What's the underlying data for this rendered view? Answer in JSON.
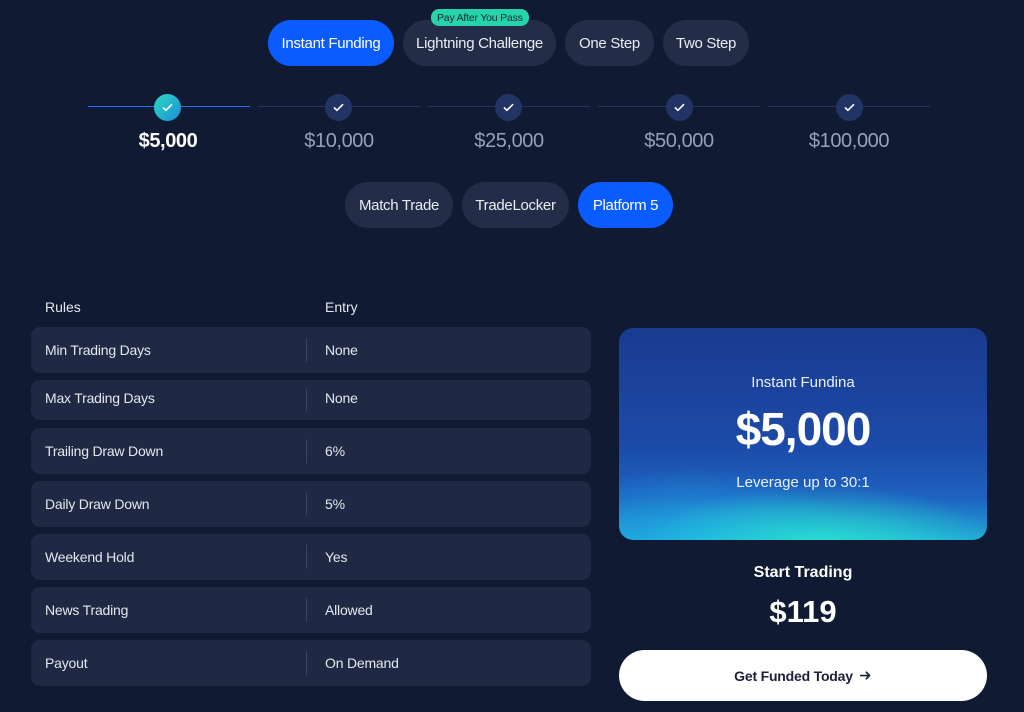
{
  "programs": {
    "items": [
      {
        "label": "Instant Funding",
        "active": true
      },
      {
        "label": "Lightning Challenge",
        "active": false
      },
      {
        "label": "One Step",
        "active": false
      },
      {
        "label": "Two Step",
        "active": false
      }
    ],
    "badge": "Pay After You Pass"
  },
  "account_sizes": [
    "$5,000",
    "$10,000",
    "$25,000",
    "$50,000",
    "$100,000"
  ],
  "selected_size_index": 0,
  "platforms": [
    {
      "label": "Match Trade",
      "active": false
    },
    {
      "label": "TradeLocker",
      "active": false
    },
    {
      "label": "Platform 5",
      "active": true
    }
  ],
  "rules_table": {
    "headers": {
      "rules": "Rules",
      "entry": "Entry"
    },
    "rows": [
      {
        "rule": "Min Trading Days",
        "entry": "None"
      },
      {
        "rule": "Max Trading Days",
        "entry": "None"
      },
      {
        "rule": "Trailing Draw Down",
        "entry": "6%"
      },
      {
        "rule": "Daily Draw Down",
        "entry": "5%"
      },
      {
        "rule": "Weekend Hold",
        "entry": "Yes"
      },
      {
        "rule": "News Trading",
        "entry": "Allowed"
      },
      {
        "rule": "Payout",
        "entry": "On Demand"
      }
    ]
  },
  "summary": {
    "title": "Instant Fundina",
    "amount": "$5,000",
    "leverage": "Leverage up to 30:1",
    "start_label": "Start Trading",
    "price": "$119",
    "cta_label": "Get Funded Today"
  },
  "icons": {
    "step": "check-icon",
    "cta": "arrow-right-icon"
  },
  "colors": {
    "accent": "#0b5cff",
    "background": "#111a33",
    "badge": "#27d3a8"
  }
}
